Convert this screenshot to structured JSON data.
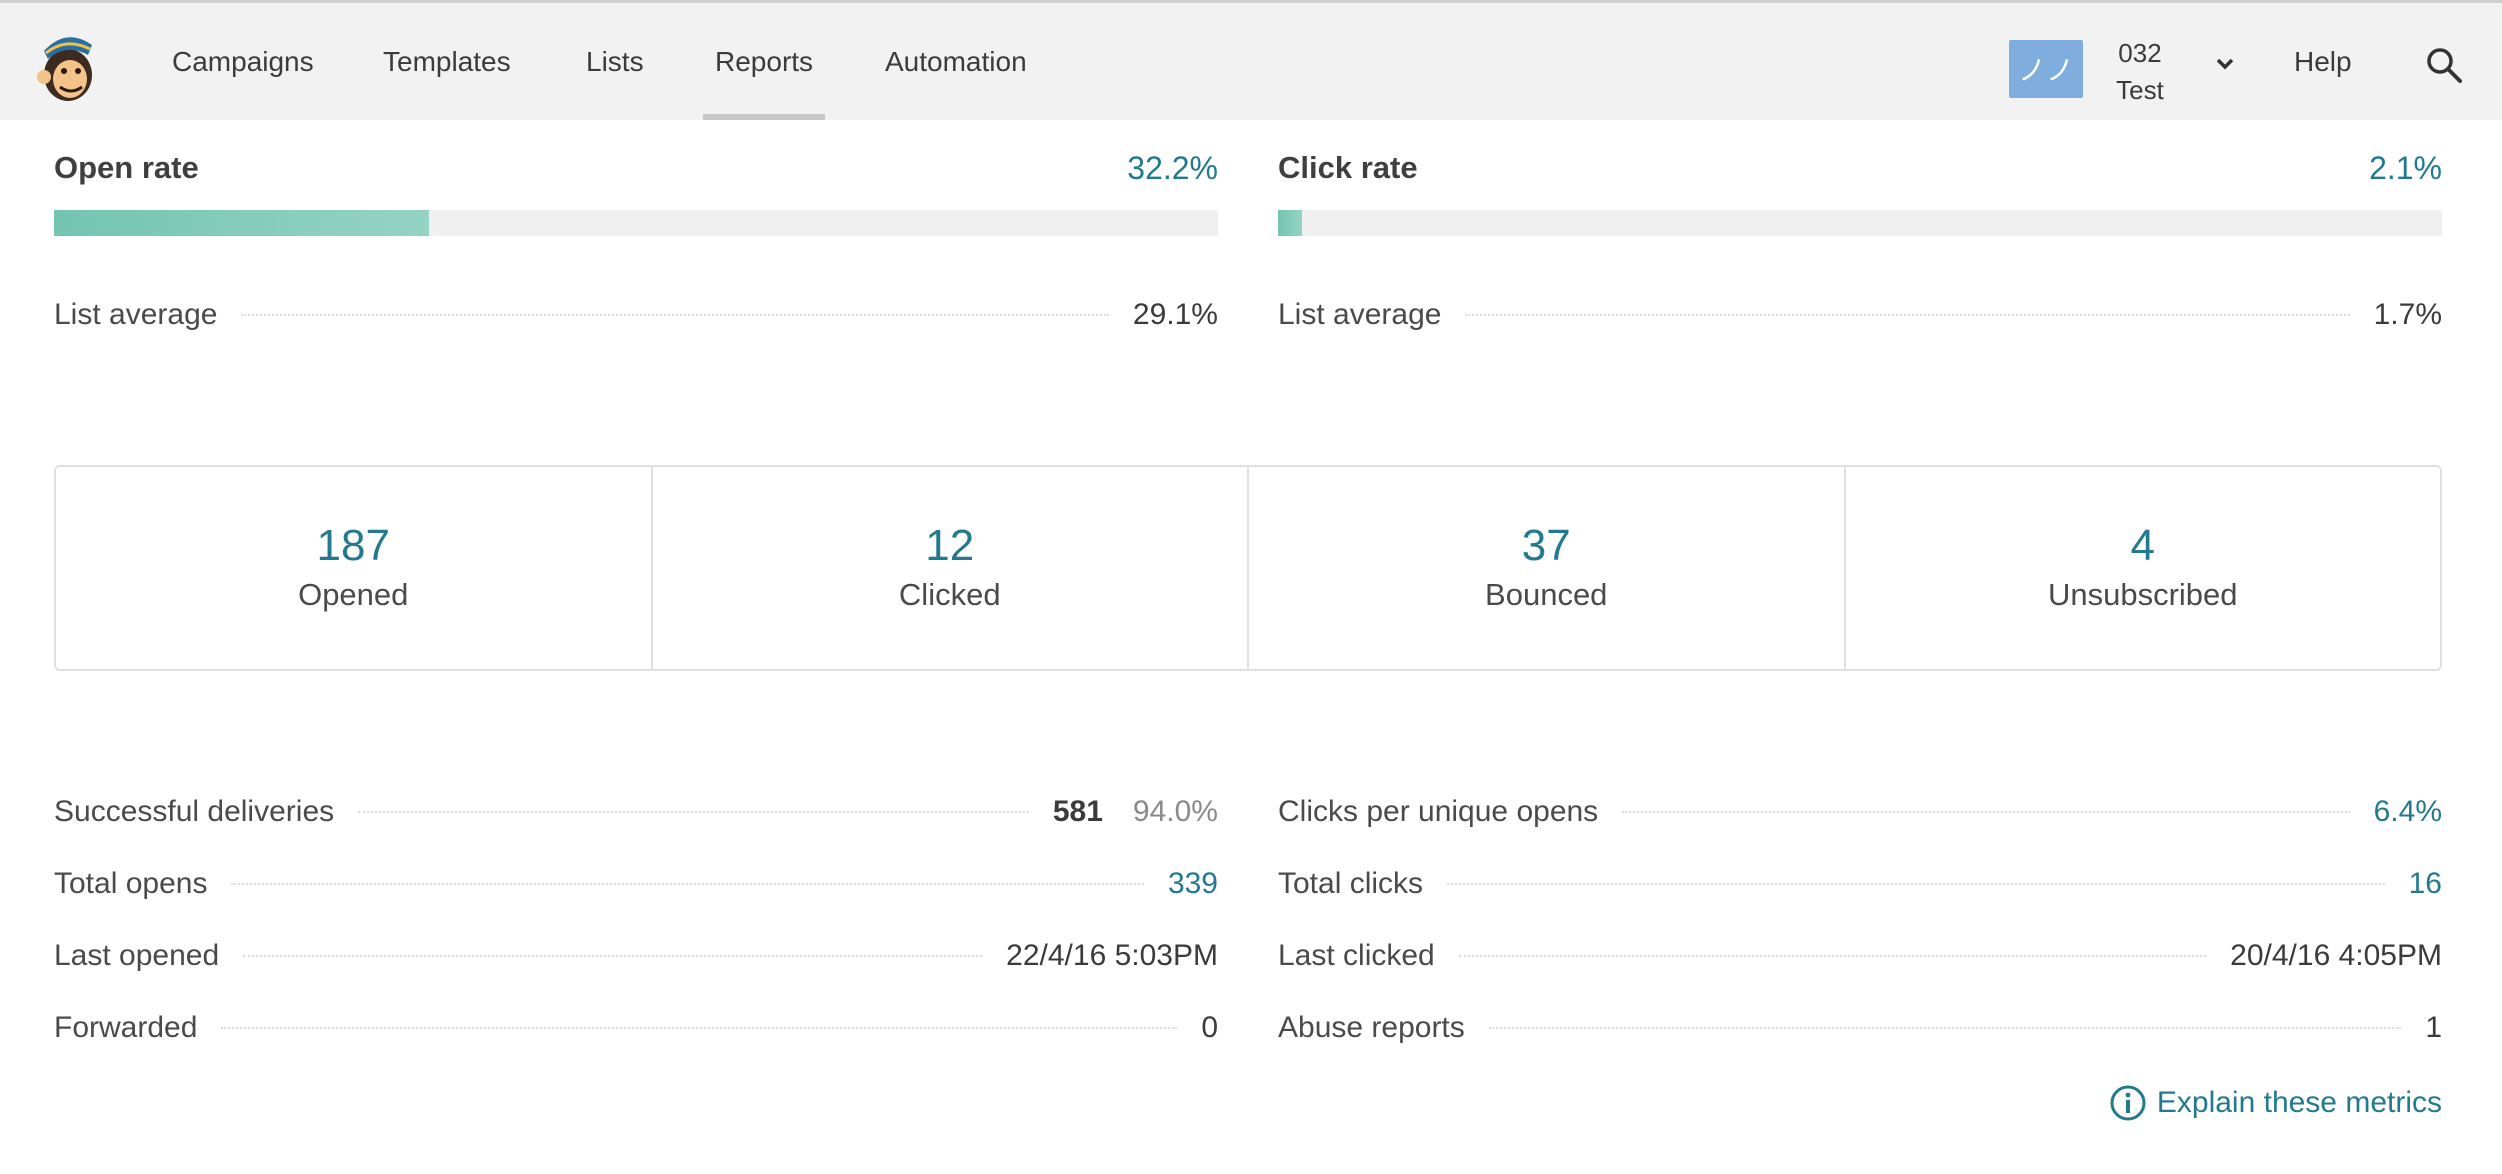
{
  "nav": {
    "items": [
      {
        "label": "Campaigns"
      },
      {
        "label": "Templates"
      },
      {
        "label": "Lists"
      },
      {
        "label": "Reports",
        "active": true
      },
      {
        "label": "Automation"
      }
    ],
    "account": {
      "line1": "032",
      "line2": "Test",
      "avatar_glyph": "ノノ"
    },
    "help_label": "Help"
  },
  "rates": {
    "open": {
      "title": "Open rate",
      "value": "32.2%",
      "fraction": 0.322,
      "avg_label": "List average",
      "avg_value": "29.1%"
    },
    "click": {
      "title": "Click rate",
      "value": "2.1%",
      "fraction": 0.021,
      "avg_label": "List average",
      "avg_value": "1.7%"
    }
  },
  "stats": [
    {
      "number": "187",
      "label": "Opened"
    },
    {
      "number": "12",
      "label": "Clicked"
    },
    {
      "number": "37",
      "label": "Bounced"
    },
    {
      "number": "4",
      "label": "Unsubscribed"
    }
  ],
  "details_left": [
    {
      "label": "Successful deliveries",
      "value": "581",
      "sub": "94.0%"
    },
    {
      "label": "Total opens",
      "value": "339"
    },
    {
      "label": "Last opened",
      "value": "22/4/16 5:03PM"
    },
    {
      "label": "Forwarded",
      "value": "0"
    }
  ],
  "details_right": [
    {
      "label": "Clicks per unique opens",
      "value": "6.4%"
    },
    {
      "label": "Total clicks",
      "value": "16"
    },
    {
      "label": "Last clicked",
      "value": "20/4/16 4:05PM"
    },
    {
      "label": "Abuse reports",
      "value": "1"
    }
  ],
  "explain_label": "Explain these metrics",
  "colors": {
    "accent": "#237a8f",
    "bar": "#7fc8b7",
    "avatar": "#7faede"
  }
}
